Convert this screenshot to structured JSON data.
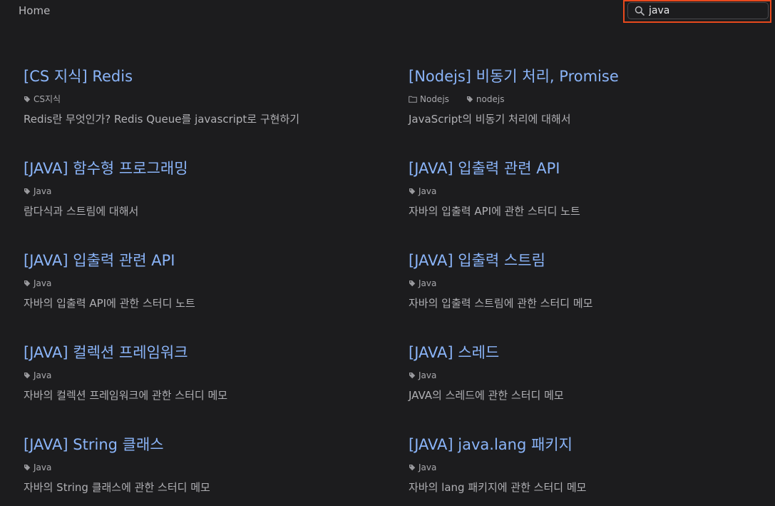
{
  "header": {
    "home_label": "Home",
    "search": {
      "value": "java",
      "placeholder": ""
    },
    "highlight_color": "#e8491d"
  },
  "posts": [
    {
      "title": "[CS 지식] Redis",
      "categories": [],
      "tags": [
        "CS지식"
      ],
      "description": "Redis란 무엇인가? Redis Queue를 javascript로 구현하기"
    },
    {
      "title": "[Nodejs] 비동기 처리, Promise",
      "categories": [
        "Nodejs"
      ],
      "tags": [
        "nodejs"
      ],
      "description": "JavaScript의 비동기 처리에 대해서"
    },
    {
      "title": "[JAVA] 함수형 프로그래밍",
      "categories": [],
      "tags": [
        "Java"
      ],
      "description": "람다식과 스트림에 대해서"
    },
    {
      "title": "[JAVA] 입출력 관련 API",
      "categories": [],
      "tags": [
        "Java"
      ],
      "description": "자바의 입출력 API에 관한 스터디 노트"
    },
    {
      "title": "[JAVA] 입출력 관련 API",
      "categories": [],
      "tags": [
        "Java"
      ],
      "description": "자바의 입출력 API에 관한 스터디 노트"
    },
    {
      "title": "[JAVA] 입출력 스트림",
      "categories": [],
      "tags": [
        "Java"
      ],
      "description": "자바의 입출력 스트림에 관한 스터디 메모"
    },
    {
      "title": "[JAVA] 컬렉션 프레임워크",
      "categories": [],
      "tags": [
        "Java"
      ],
      "description": "자바의 컬렉션 프레임워크에 관한 스터디 메모"
    },
    {
      "title": "[JAVA] 스레드",
      "categories": [],
      "tags": [
        "Java"
      ],
      "description": "JAVA의 스레드에 관한 스터디 메모"
    },
    {
      "title": "[JAVA] String 클래스",
      "categories": [],
      "tags": [
        "Java"
      ],
      "description": "자바의 String 클래스에 관한 스터디 메모"
    },
    {
      "title": "[JAVA] java.lang 패키지",
      "categories": [],
      "tags": [
        "Java"
      ],
      "description": "자바의 lang 패키지에 관한 스터디 메모"
    }
  ],
  "icons": {
    "search": "search-icon",
    "tag": "tag-icon",
    "folder": "folder-icon"
  },
  "colors": {
    "background": "#1c1c1e",
    "title_link": "#8ab4f8",
    "body_text": "#b0b0b4"
  }
}
